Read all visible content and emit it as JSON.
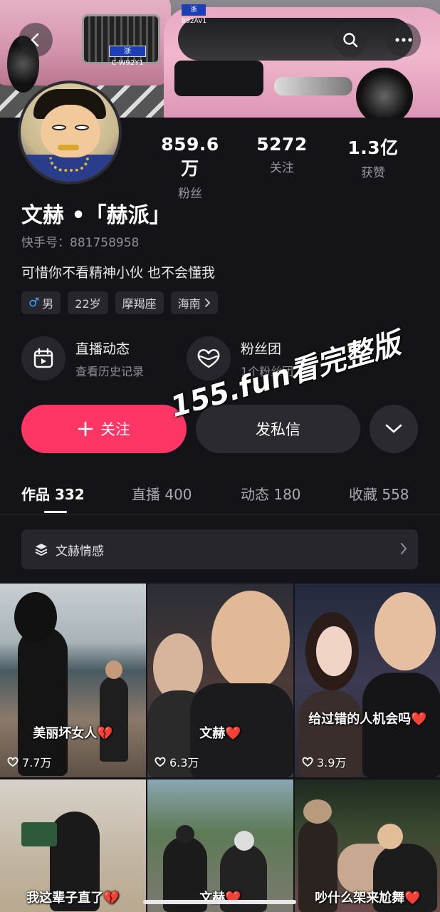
{
  "banner": {
    "plate_left": "浙C·W92Y1",
    "plate_right": "浙B92AV1"
  },
  "stats": {
    "fans_value": "859.6万",
    "fans_label": "粉丝",
    "following_value": "5272",
    "following_label": "关注",
    "likes_value": "1.3亿",
    "likes_label": "获赞"
  },
  "profile": {
    "name": "文赫 •「赫派」",
    "uid": "快手号：881758958",
    "bio": "可惜你不看精神小伙 也不会懂我",
    "tags": [
      "男",
      "22岁",
      "摩羯座",
      "海南"
    ]
  },
  "features": {
    "live_title": "直播动态",
    "live_sub": "查看历史记录",
    "fan_title": "粉丝团",
    "fan_sub": "1个粉丝团"
  },
  "actions": {
    "follow_label": "关注",
    "message_label": "发私信"
  },
  "watermark": "155.fun看完整版",
  "tabs": [
    {
      "label": "作品 332"
    },
    {
      "label": "直播 400"
    },
    {
      "label": "动态 180"
    },
    {
      "label": "收藏 558"
    }
  ],
  "collection": {
    "label": "文赫情感"
  },
  "videos": [
    {
      "caption": "美丽坏女人",
      "likes": "7.7万"
    },
    {
      "caption": "文赫",
      "likes": "6.3万"
    },
    {
      "caption": "给过错的人机会吗",
      "likes": "3.9万"
    },
    {
      "caption": "我这辈子直了",
      "likes": ""
    },
    {
      "caption": "文赫",
      "likes": ""
    },
    {
      "caption": "吵什么架来尬舞",
      "likes": ""
    }
  ],
  "colors": {
    "accent": "#fe3666",
    "background": "#141418",
    "surface": "#26262c"
  }
}
